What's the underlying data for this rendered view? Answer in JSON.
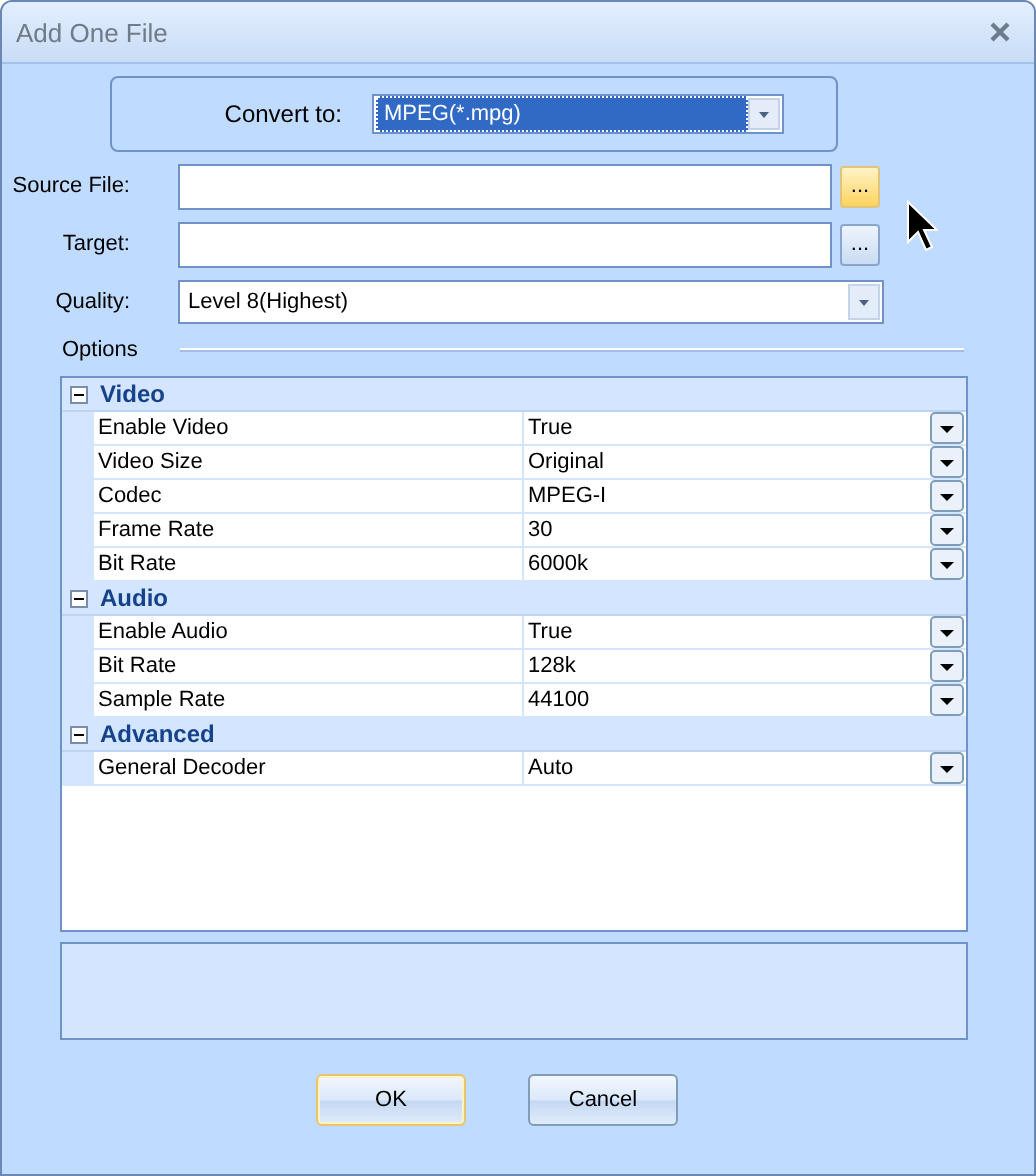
{
  "window": {
    "title": "Add One File"
  },
  "convert": {
    "label": "Convert to:",
    "value": "MPEG(*.mpg)",
    "selected": true
  },
  "fields": [
    {
      "label": "Source File:",
      "browse": "...",
      "hovered": true
    },
    {
      "label": "Target:",
      "browse": "...",
      "hovered": false
    }
  ],
  "quality": {
    "label": "Quality:",
    "value": "Level 8(Highest)"
  },
  "options": {
    "label": "Options",
    "groups": [
      {
        "name": "Video",
        "expanded": true,
        "rows": [
          {
            "name": "Enable Video",
            "value": "True"
          },
          {
            "name": "Video Size",
            "value": "Original"
          },
          {
            "name": "Codec",
            "value": "MPEG-I"
          },
          {
            "name": "Frame Rate",
            "value": "30"
          },
          {
            "name": "Bit Rate",
            "value": "6000k"
          }
        ]
      },
      {
        "name": "Audio",
        "expanded": true,
        "rows": [
          {
            "name": "Enable Audio",
            "value": "True"
          },
          {
            "name": "Bit Rate",
            "value": "128k"
          },
          {
            "name": "Sample Rate",
            "value": "44100"
          }
        ]
      },
      {
        "name": "Advanced",
        "expanded": true,
        "rows": [
          {
            "name": "General Decoder",
            "value": "Auto"
          }
        ]
      }
    ]
  },
  "buttons": [
    {
      "label": "OK",
      "default": true
    },
    {
      "label": "Cancel",
      "default": false
    }
  ]
}
